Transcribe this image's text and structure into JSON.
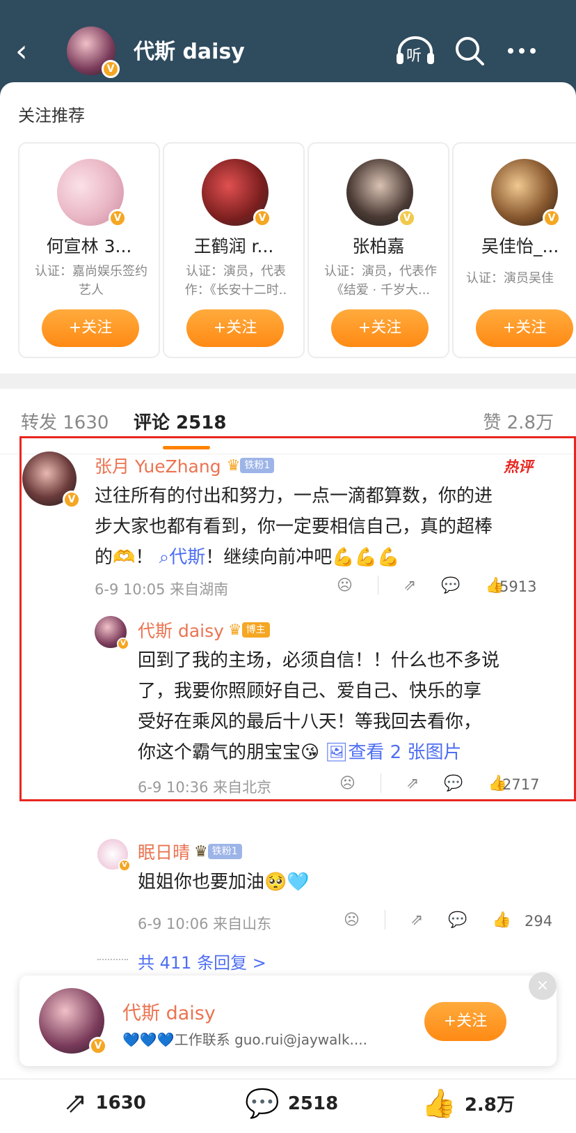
{
  "header": {
    "title": "代斯 daisy",
    "listen_label": "听"
  },
  "recommend": {
    "title": "关注推荐",
    "cards": [
      {
        "name": "何宣林 3...",
        "desc": "认证：嘉尚娱乐签约艺人",
        "button": "+关注"
      },
      {
        "name": "王鹤润 r...",
        "desc": "认证：演员，代表作：《长安十二时..",
        "button": "+关注"
      },
      {
        "name": "张柏嘉",
        "desc": "认证：演员，代表作《结爱 · 千岁大...",
        "button": "+关注"
      },
      {
        "name": "吴佳怡_...",
        "desc": "认证：演员吴佳",
        "button": "+关注"
      }
    ]
  },
  "tabs": {
    "repost": "转发 1630",
    "comments": "评论 2518",
    "likes": "赞 2.8万"
  },
  "comment": {
    "name": "张月 YueZhang",
    "badge": "铁粉1",
    "hot": "热评",
    "text_line1": "过往所有的付出和努力，一点一滴都算数，你的进",
    "text_line2": "步大家也都有看到，你一定要相信自己，真的超棒",
    "text_line3_pre": "的🫶！",
    "mention": "代斯",
    "text_line3_post": "！继续向前冲吧💪💪💪",
    "time": "6-9 10:05 来自湖南",
    "likes": "5913"
  },
  "reply1": {
    "name": "代斯 daisy",
    "badge": "博主",
    "line1": "回到了我的主场，必须自信！！什么也不多说",
    "line2": "了，我要你照顾好自己、爱自己、快乐的享",
    "line3": "受好在乘风的最后十八天！等我回去看你，",
    "line4": "你这个霸气的朋宝宝😘",
    "view_images": "查看 2 张图片",
    "time": "6-9 10:36 来自北京",
    "likes": "2717"
  },
  "reply2": {
    "name": "眠日晴",
    "badge": "铁粉1",
    "text": "姐姐你也要加油🥺🩵",
    "time": "6-9 10:06 来自山东",
    "likes": "294"
  },
  "more_replies": "共 411 条回复 >",
  "follow_card": {
    "name": "代斯 daisy",
    "bio": "💙💙💙工作联系 guo.rui@jaywalk....",
    "button": "+关注"
  },
  "bottom_bar": {
    "repost": "1630",
    "comments": "2518",
    "likes": "2.8万"
  }
}
